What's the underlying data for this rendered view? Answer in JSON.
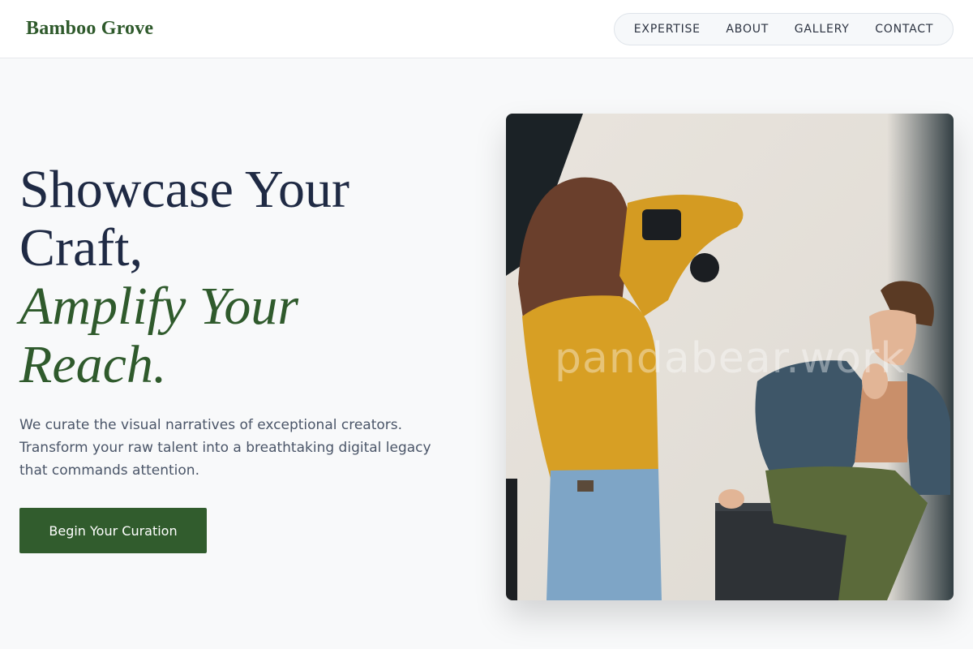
{
  "brand": {
    "name": "Bamboo Grove"
  },
  "nav": {
    "items": [
      {
        "label": "EXPERTISE"
      },
      {
        "label": "ABOUT"
      },
      {
        "label": "GALLERY"
      },
      {
        "label": "CONTACT"
      }
    ]
  },
  "hero": {
    "title_line1": "Showcase Your",
    "title_line2": "Craft,",
    "title_line3": "Amplify Your",
    "title_line4": "Reach.",
    "subtitle": "We curate the visual narratives of exceptional creators. Transform your raw talent into a breathtaking digital legacy that commands attention.",
    "cta_label": "Begin Your Curation"
  },
  "photo": {
    "watermark": "pandabear.work"
  },
  "colors": {
    "brand_green": "#2f5a2c",
    "heading_navy": "#1f2a44",
    "body_gray": "#4a5568",
    "button_green": "#315c2d",
    "page_bg": "#f8f9fa"
  }
}
